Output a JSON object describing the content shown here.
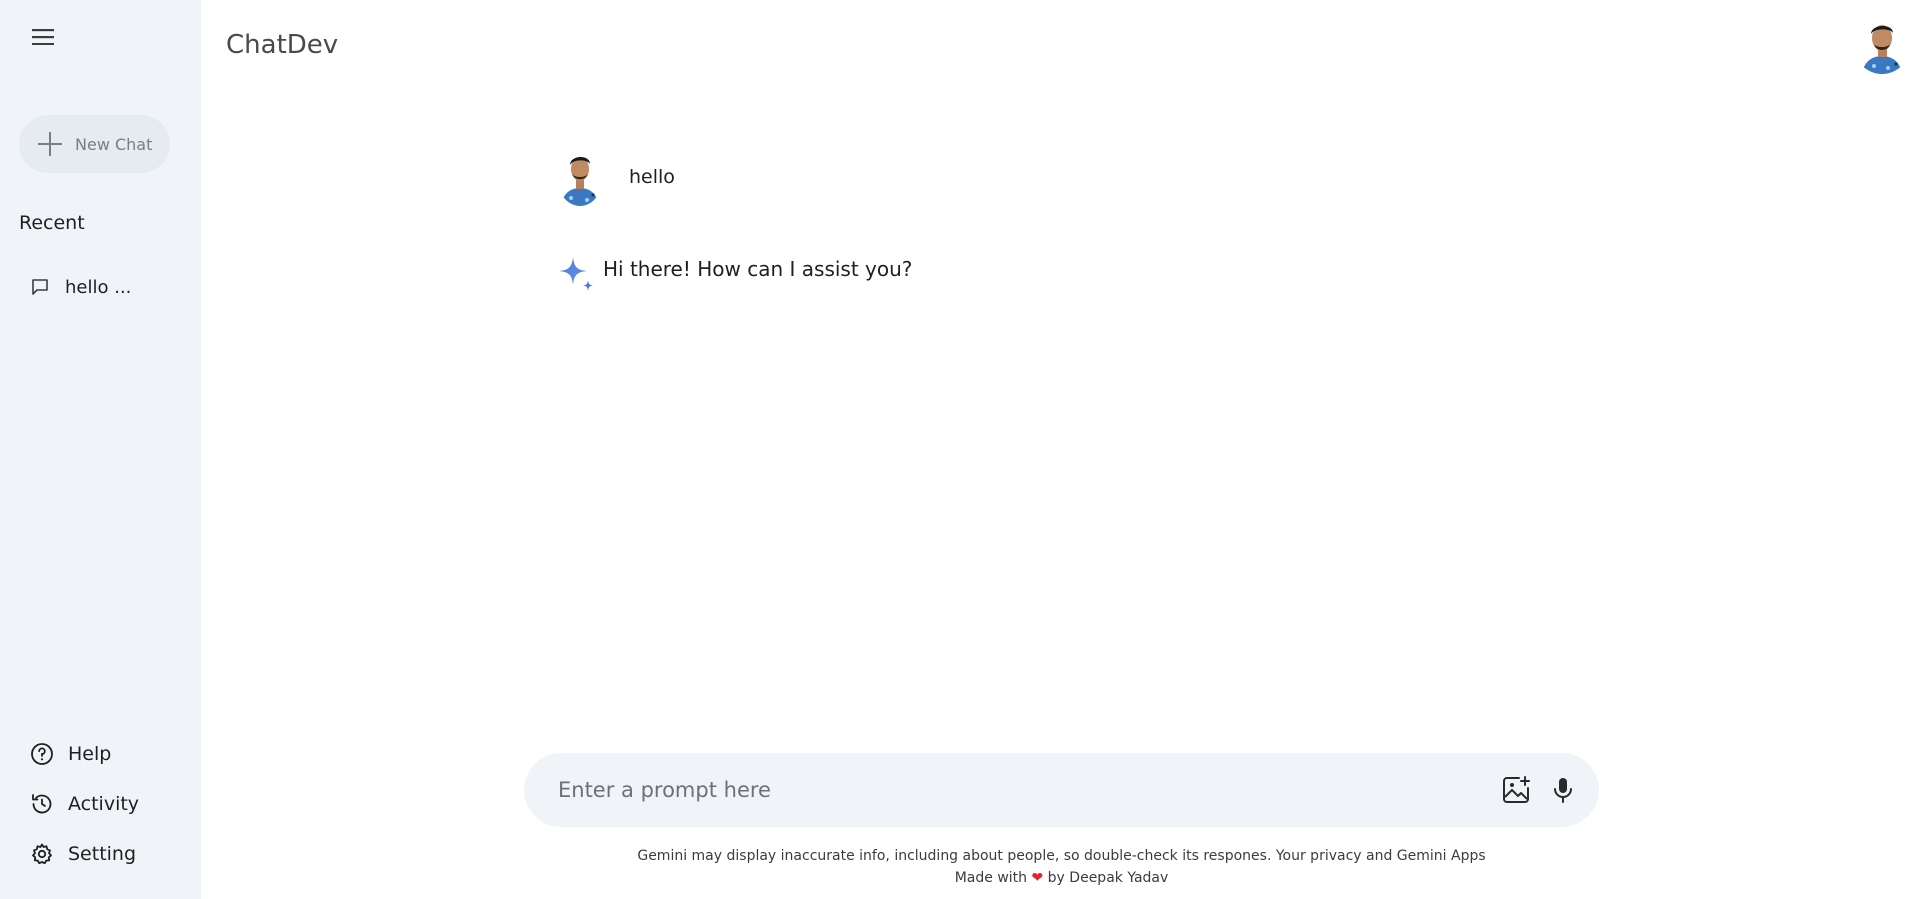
{
  "sidebar": {
    "new_chat_label": "New Chat",
    "recent_title": "Recent",
    "recent_items": [
      {
        "label": "hello ..."
      }
    ],
    "bottom_items": [
      {
        "label": "Help",
        "icon": "help-circle-icon"
      },
      {
        "label": "Activity",
        "icon": "history-icon"
      },
      {
        "label": "Setting",
        "icon": "gear-icon"
      }
    ]
  },
  "header": {
    "title": "ChatDev"
  },
  "chat": {
    "user_message": "hello",
    "bot_message": "Hi there! How can I assist you?"
  },
  "prompt": {
    "placeholder": "Enter a prompt here",
    "value": ""
  },
  "footer": {
    "disclaimer": "Gemini may display inaccurate info, including about people, so double-check its respones. Your privacy and Gemini Apps",
    "made_with_prefix": "Made with",
    "heart": "❤",
    "made_with_suffix": "by Deepak Yadav"
  },
  "colors": {
    "sidebar_bg": "#f0f4f9",
    "prompt_bg": "#f0f4f9",
    "gemini_blue": "#4b7bd8",
    "heart_red": "#e0242b"
  }
}
